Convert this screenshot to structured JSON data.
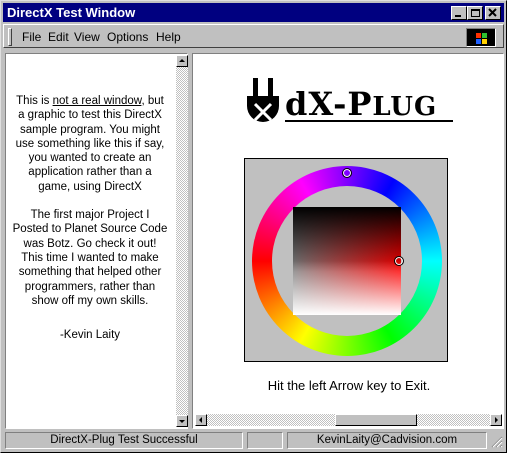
{
  "window": {
    "title": "DirectX Test Window"
  },
  "menu": {
    "items": [
      "File",
      "Edit",
      "View",
      "Options",
      "Help"
    ]
  },
  "left_pane": {
    "para1_prefix": "This is ",
    "para1_link": "not a real window",
    "para1_rest": ", but a graphic to test this DirectX sample program. You might use something like this if say, you wanted to create an application rather than a game, using DirectX",
    "para2": "The first major Project I Posted to Planet Source Code was Botz.  Go check it out!  This time I wanted to make something that helped other programmers, rather than show off my own skills.",
    "signature": "-Kevin Laity"
  },
  "right_pane": {
    "logo_letters": "dX-",
    "logo_p": "P",
    "logo_rest": "LUG",
    "exit_hint": "Hit the left Arrow key to Exit."
  },
  "color_picker": {
    "hue_degrees": 0,
    "saturation": 0.95,
    "value": 0.55
  },
  "status": {
    "left": "DirectX-Plug Test Successful",
    "middle": "",
    "right": "KevinLaity@Cadvision.com"
  },
  "colors": {
    "titlebar": "#000080",
    "chrome": "#c0c0c0",
    "pane": "#ffffff"
  }
}
